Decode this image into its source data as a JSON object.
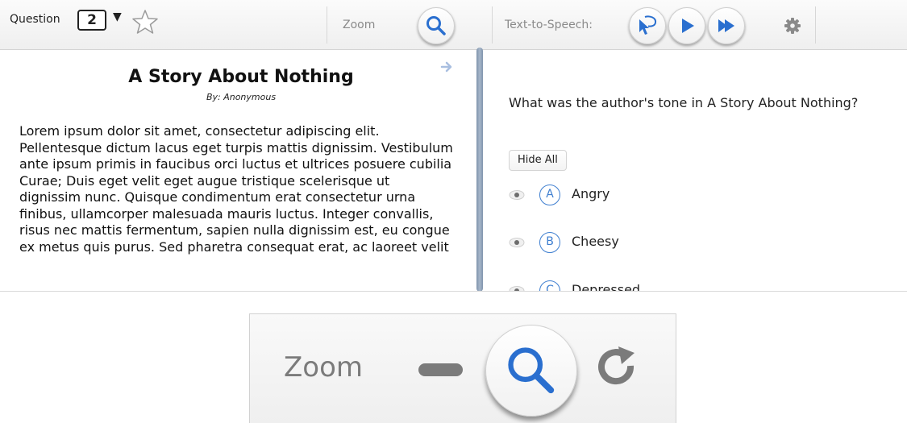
{
  "toolbar": {
    "question_label": "Question",
    "question_number": "2",
    "dropdown_arrow": "▼",
    "zoom_label": "Zoom",
    "tts_label": "Text-to-Speech:"
  },
  "passage": {
    "title": "A Story About Nothing",
    "byline": "By: Anonymous",
    "body": "Lorem ipsum dolor sit amet, consectetur adipiscing elit. Pellentesque dictum lacus eget turpis mattis dignissim. Vestibulum ante ipsum primis in faucibus orci luctus et ultrices posuere cubilia Curae; Duis eget velit eget augue tristique scelerisque ut dignissim nunc. Quisque condimentum erat consectetur urna finibus, ullamcorper malesuada mauris luctus. Integer convallis, risus nec mattis fermentum, sapien nulla dignissim est, eu congue ex metus quis purus. Sed pharetra consequat erat, ac laoreet velit"
  },
  "question": {
    "text": "What was the author's tone in A Story About Nothing?",
    "hide_all_label": "Hide All",
    "options": [
      {
        "letter": "A",
        "text": "Angry"
      },
      {
        "letter": "B",
        "text": "Cheesy"
      },
      {
        "letter": "C",
        "text": "Depressed"
      }
    ]
  },
  "zoom_closeup": {
    "label": "Zoom"
  },
  "icons": {
    "star": "star-outline-icon",
    "search": "magnifier-icon",
    "point_speak": "cursor-speech-icon",
    "play": "play-icon",
    "fast_forward": "fast-forward-icon",
    "settings": "gear-icon",
    "expand": "arrow-right-icon",
    "visibility": "eye-icon",
    "zoom_out": "minus-icon",
    "reset": "refresh-icon"
  },
  "colors": {
    "accent_blue": "#2a6fcf",
    "option_blue": "#3f7fd0",
    "splitter": "#8094ad",
    "muted_text": "#8a8a8a"
  }
}
